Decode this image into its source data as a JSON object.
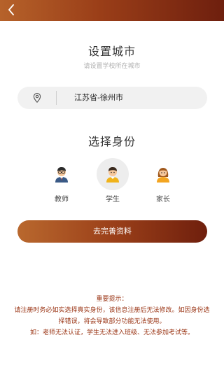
{
  "header": {
    "back_icon": "chevron-left-icon"
  },
  "city_section": {
    "title": "设置城市",
    "subtitle": "请设置学校所在城市",
    "location_icon": "location-pin-icon",
    "city_value": "江苏省-徐州市"
  },
  "identity_section": {
    "title": "选择身份",
    "roles": [
      {
        "label": "教师",
        "icon": "teacher-avatar-icon",
        "selected": false
      },
      {
        "label": "学生",
        "icon": "student-avatar-icon",
        "selected": true
      },
      {
        "label": "家长",
        "icon": "parent-avatar-icon",
        "selected": false
      }
    ]
  },
  "submit_label": "去完善资料",
  "notice": {
    "title": "重要提示：",
    "line1": "请注册时务必如实选择真实身份，该信息注册后无法修改。如因身份选",
    "line2": "择错误，将会导致部分功能无法使用。",
    "line3": "如：老师无法认证，学生无法进入班级、无法参加考试等。"
  },
  "colors": {
    "brand_gradient_start": "#b9682e",
    "brand_gradient_end": "#6f1f0d",
    "notice_text": "#9a3414",
    "field_background": "#f1f1f1"
  }
}
